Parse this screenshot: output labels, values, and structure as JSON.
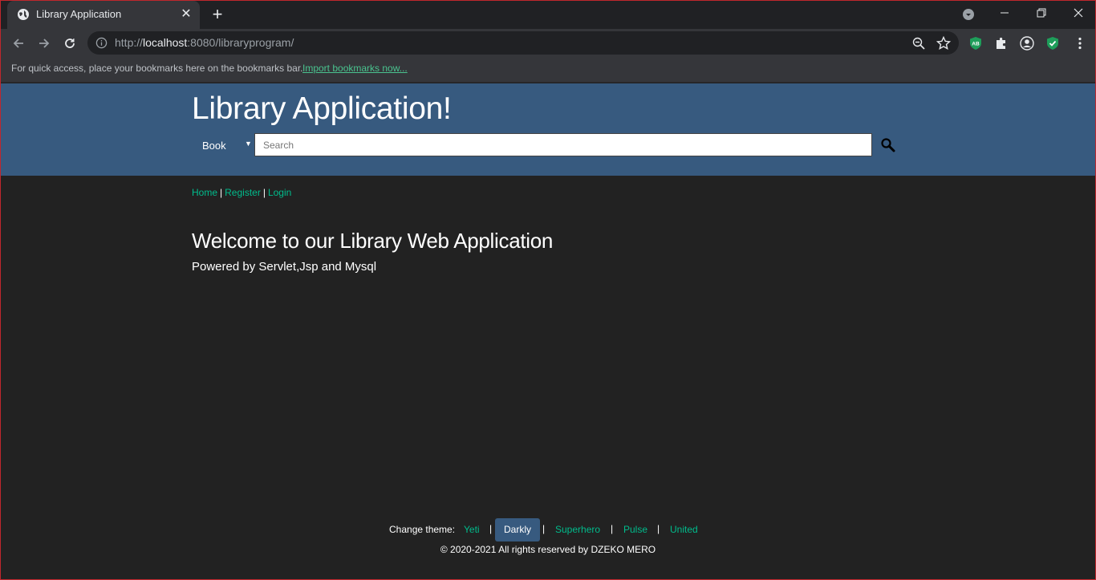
{
  "browser": {
    "tab_title": "Library Application",
    "url_prefix": "http://",
    "url_host": "localhost",
    "url_rest": ":8080/libraryprogram/",
    "bookmarks_text": "For quick access, place your bookmarks here on the bookmarks bar.",
    "bookmarks_link": "Import bookmarks now...",
    "extension_badge": "AB"
  },
  "header": {
    "title": "Library Application!",
    "search_type": "Book",
    "search_placeholder": "Search"
  },
  "nav": {
    "home": "Home",
    "register": "Register",
    "login": "Login",
    "separator": "|"
  },
  "main": {
    "heading": "Welcome to our Library Web Application",
    "subheading": "Powered by Servlet,Jsp and Mysql"
  },
  "footer": {
    "change_theme_label": "Change theme:",
    "themes": [
      "Yeti",
      "Darkly",
      "Superhero",
      "Pulse",
      "United"
    ],
    "active_theme": "Darkly",
    "copyright": "© 2020-2021 All rights reserved by DZEKO MERO"
  },
  "colors": {
    "header_bg": "#375a7f",
    "page_bg": "#222222",
    "link": "#00bc8c"
  }
}
